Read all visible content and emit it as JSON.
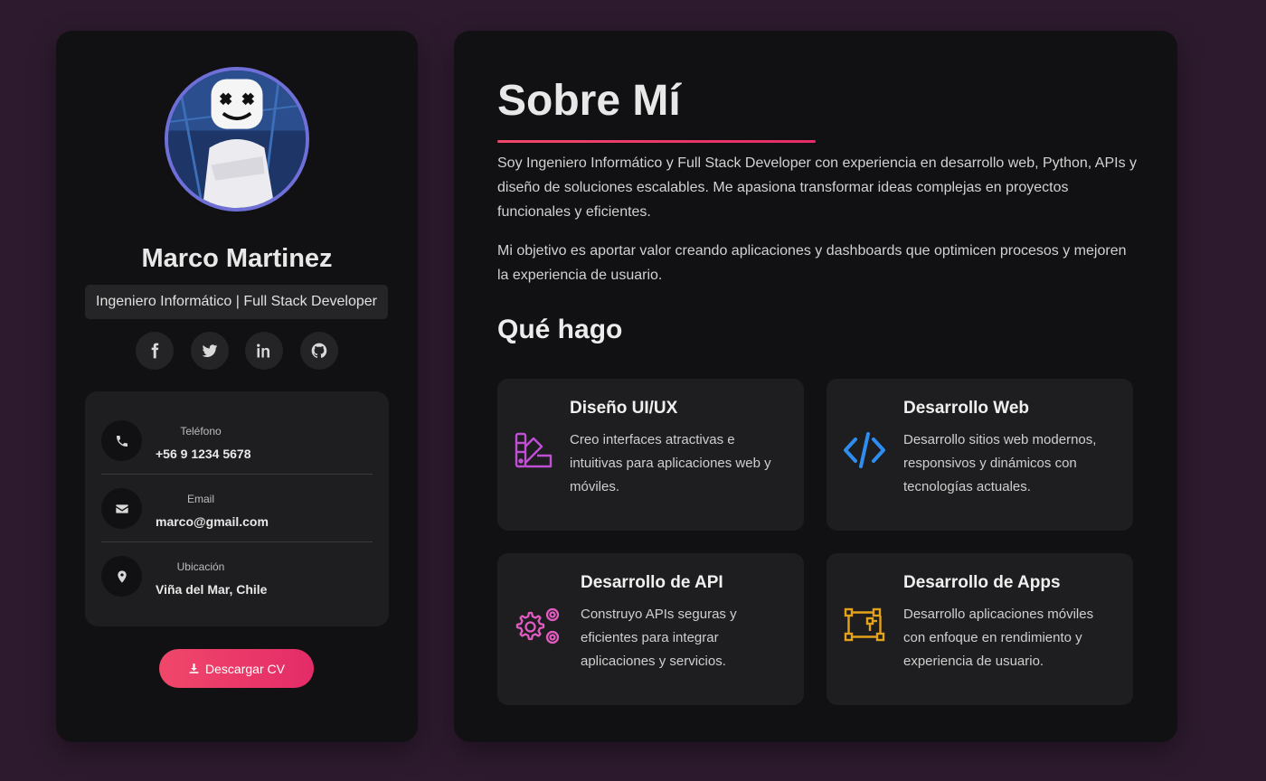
{
  "profile": {
    "name": "Marco Martinez",
    "role": "Ingeniero Informático | Full Stack Developer"
  },
  "socials": [
    {
      "icon": "facebook-icon"
    },
    {
      "icon": "twitter-icon"
    },
    {
      "icon": "linkedin-icon"
    },
    {
      "icon": "github-icon"
    }
  ],
  "contacts": [
    {
      "label": "Teléfono",
      "value": "+56 9 1234 5678",
      "icon": "phone-icon"
    },
    {
      "label": "Email",
      "value": "marco@gmail.com",
      "icon": "envelope-icon"
    },
    {
      "label": "Ubicación",
      "value": "Viña del Mar, Chile",
      "icon": "location-pin-icon"
    }
  ],
  "cv_button": {
    "label": "Descargar CV",
    "icon": "download-icon"
  },
  "about": {
    "title": "Sobre Mí",
    "paragraphs": [
      "Soy Ingeniero Informático y Full Stack Developer con experiencia en desarrollo web, Python, APIs y diseño de soluciones escalables. Me apasiona transformar ideas complejas en proyectos funcionales y eficientes.",
      "Mi objetivo es aportar valor creando aplicaciones y dashboards que optimicen procesos y mejoren la experiencia de usuario."
    ]
  },
  "services": {
    "title": "Qué hago",
    "items": [
      {
        "title": "Diseño UI/UX",
        "description": "Creo interfaces atractivas e intuitivas para aplicaciones web y móviles.",
        "icon": "design-swatches-icon",
        "color": "#c04fd6"
      },
      {
        "title": "Desarrollo Web",
        "description": "Desarrollo sitios web modernos, responsivos y dinámicos con tecnologías actuales.",
        "icon": "code-icon",
        "color": "#2d8ef0"
      },
      {
        "title": "Desarrollo de API",
        "description": "Construyo APIs seguras y eficientes para integrar aplicaciones y servicios.",
        "icon": "gears-icon",
        "color": "#e25bc0"
      },
      {
        "title": "Desarrollo de Apps",
        "description": "Desarrollo aplicaciones móviles con enfoque en rendimiento y experiencia de usuario.",
        "icon": "nodes-diagram-icon",
        "color": "#e3a21a"
      }
    ]
  },
  "colors": {
    "background": "#2d1a2e",
    "panel": "#111113",
    "card": "#1e1e20",
    "accent": "#e9385f",
    "avatar_border": "#6f6fd8"
  }
}
